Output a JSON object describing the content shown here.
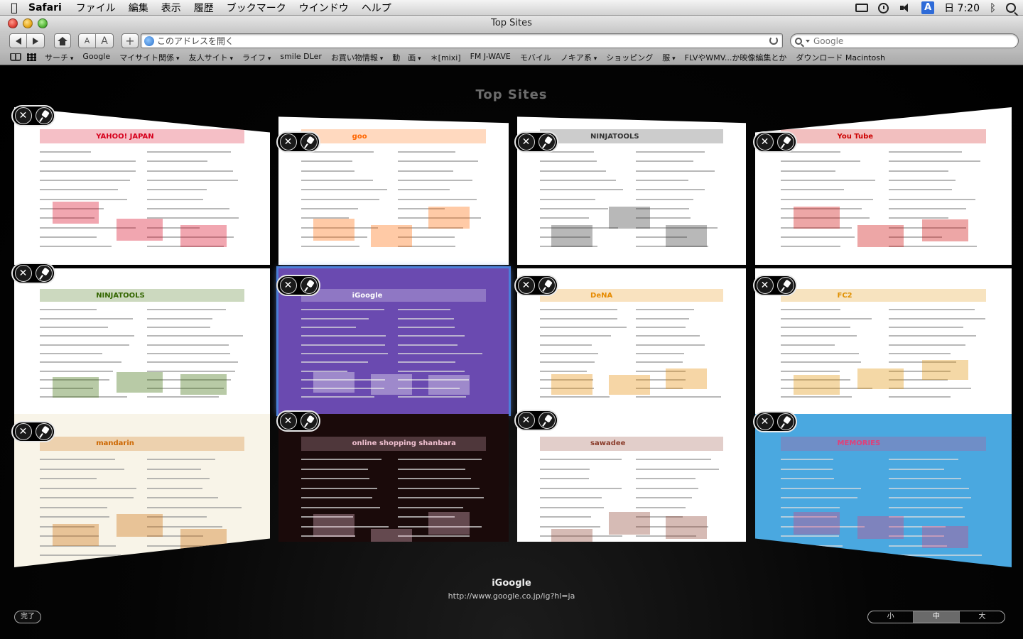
{
  "menubar": {
    "app": "Safari",
    "items": [
      "ファイル",
      "編集",
      "表示",
      "履歴",
      "ブックマーク",
      "ウインドウ",
      "ヘルプ"
    ],
    "input_mode": "A",
    "clock": "日 7:20"
  },
  "window": {
    "title": "Top Sites"
  },
  "toolbar": {
    "text_small": "A",
    "text_large": "A",
    "add": "+",
    "address_placeholder": "このアドレスを開く",
    "search_placeholder": "Google"
  },
  "bookmarks": [
    {
      "label": "サーチ",
      "menu": true
    },
    {
      "label": "Google",
      "menu": false
    },
    {
      "label": "マイサイト関係",
      "menu": true
    },
    {
      "label": "友人サイト",
      "menu": true
    },
    {
      "label": "ライフ",
      "menu": true
    },
    {
      "label": "smile DLer",
      "menu": false
    },
    {
      "label": "お買い物情報",
      "menu": true
    },
    {
      "label": "動　画",
      "menu": true
    },
    {
      "label": "＊[mixi]",
      "menu": false
    },
    {
      "label": "FM J-WAVE",
      "menu": false
    },
    {
      "label": "モバイル",
      "menu": false
    },
    {
      "label": "ノキア系",
      "menu": true
    },
    {
      "label": "ショッピング",
      "menu": false
    },
    {
      "label": "服",
      "menu": true
    },
    {
      "label": "FLVやWMV...か映像編集とか",
      "menu": false
    },
    {
      "label": "ダウンロード Macintosh",
      "menu": false
    }
  ],
  "top_sites": {
    "heading": "Top Sites",
    "tiles": [
      {
        "label": "YAHOO! JAPAN",
        "color": "#d6001c",
        "bg": "#ffffff"
      },
      {
        "label": "goo",
        "color": "#ff6600",
        "bg": "#ffffff"
      },
      {
        "label": "NINJATOOLS",
        "color": "#333333",
        "bg": "#ffffff"
      },
      {
        "label": "You Tube",
        "color": "#cc0000",
        "bg": "#ffffff"
      },
      {
        "label": "NINJATOOLS",
        "color": "#336600",
        "bg": "#ffffff"
      },
      {
        "label": "iGoogle",
        "color": "#ffffff",
        "bg": "#6a4ab0"
      },
      {
        "label": "DeNA",
        "color": "#e68a00",
        "bg": "#ffffff"
      },
      {
        "label": "FC2",
        "color": "#e09000",
        "bg": "#ffffff"
      },
      {
        "label": "mandarin",
        "color": "#cc6600",
        "bg": "#f8f4e8"
      },
      {
        "label": "online shopping shanbara",
        "color": "#f0c0d0",
        "bg": "#1a0a0a"
      },
      {
        "label": "sawadee",
        "color": "#8a3b2a",
        "bg": "#ffffff"
      },
      {
        "label": "MEMORIES",
        "color": "#e0407a",
        "bg": "#4aa8e0"
      }
    ],
    "selected_title": "iGoogle",
    "selected_url": "http://www.google.co.jp/ig?hl=ja",
    "done_label": "完了",
    "sizes": [
      "小",
      "中",
      "大"
    ],
    "active_size": "中"
  }
}
